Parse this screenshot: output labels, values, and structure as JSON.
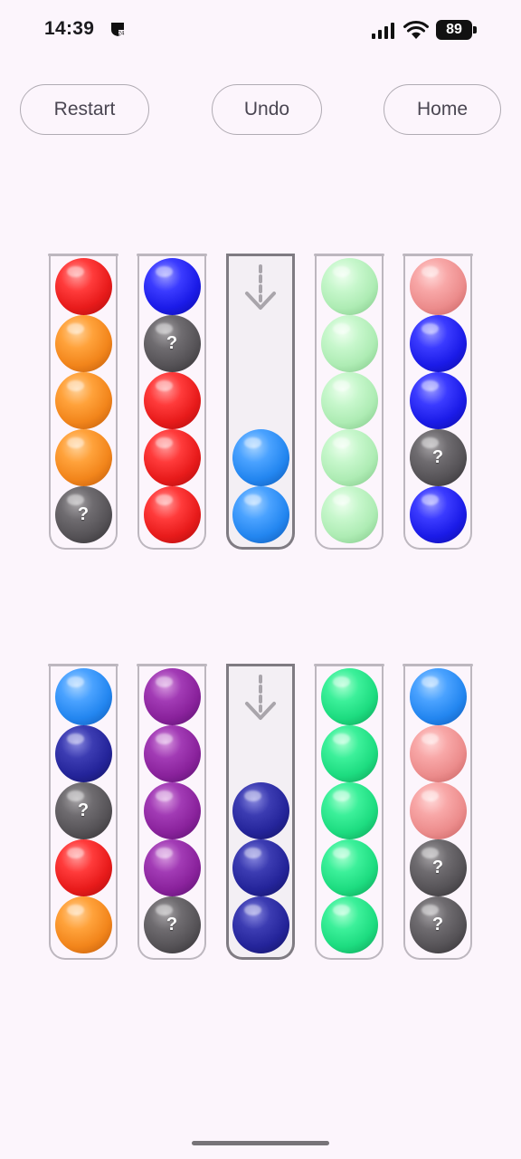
{
  "status_bar": {
    "time": "14:39",
    "battery": "89",
    "icons": [
      "notification-icon",
      "signal-icon",
      "wifi-icon",
      "battery-icon"
    ]
  },
  "toolbar": {
    "restart_label": "Restart",
    "undo_label": "Undo",
    "home_label": "Home"
  },
  "hidden_ball_label": "?",
  "colors": {
    "red": "#e81b1b",
    "orange": "#f2851b",
    "gray": "#565357",
    "blue": "#1b1be8",
    "skyblue": "#2386f0",
    "mint": "#aeecb4",
    "pink": "#ec8c8c",
    "navy": "#24249a",
    "purple": "#8a229c",
    "green": "#1ddc80"
  },
  "board": {
    "capacity": 5,
    "rows": [
      {
        "tubes": [
          {
            "selected": false,
            "balls": [
              "red",
              "orange",
              "orange",
              "orange",
              "hidden"
            ]
          },
          {
            "selected": false,
            "balls": [
              "blue",
              "hidden",
              "red",
              "red",
              "red"
            ]
          },
          {
            "selected": true,
            "balls": [
              "skyblue",
              "skyblue"
            ]
          },
          {
            "selected": false,
            "balls": [
              "mint",
              "mint",
              "mint",
              "mint",
              "mint"
            ]
          },
          {
            "selected": false,
            "balls": [
              "pink",
              "blue",
              "blue",
              "hidden",
              "blue"
            ]
          }
        ]
      },
      {
        "tubes": [
          {
            "selected": false,
            "balls": [
              "skyblue",
              "navy",
              "hidden",
              "red",
              "orange"
            ]
          },
          {
            "selected": false,
            "balls": [
              "purple",
              "purple",
              "purple",
              "purple",
              "hidden"
            ]
          },
          {
            "selected": true,
            "balls": [
              "navy",
              "navy",
              "navy"
            ]
          },
          {
            "selected": false,
            "balls": [
              "green",
              "green",
              "green",
              "green",
              "green"
            ]
          },
          {
            "selected": false,
            "balls": [
              "skyblue",
              "pink",
              "pink",
              "hidden",
              "hidden"
            ]
          }
        ]
      }
    ]
  }
}
